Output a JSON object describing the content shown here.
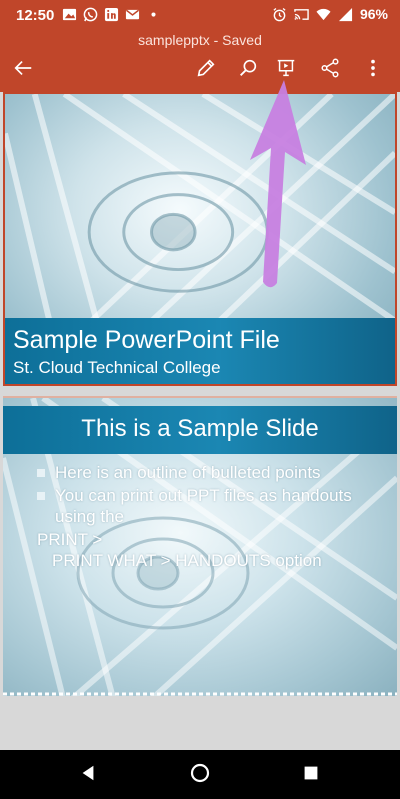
{
  "status_bar": {
    "time": "12:50",
    "battery": "96%",
    "left_icons": [
      "photo-icon",
      "whatsapp-icon",
      "linkedin-icon",
      "gmail-icon",
      "dot-icon"
    ],
    "right_icons": [
      "alarm-icon",
      "cast-icon",
      "wifi-icon",
      "signal-icon"
    ]
  },
  "app_bar": {
    "title": "samplepptx - Saved",
    "color": "#c0462a",
    "actions": [
      "back-arrow-icon",
      "edit-pencil-icon",
      "search-icon",
      "present-icon",
      "share-icon",
      "more-vertical-icon"
    ]
  },
  "slides": [
    {
      "title": "Sample PowerPoint File",
      "subtitle": "St. Cloud Technical College"
    },
    {
      "title": "This is a Sample Slide",
      "bullets": [
        "Here is an outline of bulleted points",
        "You can print out PPT files as handouts using the"
      ],
      "continuation": [
        "PRINT >",
        "PRINT WHAT > HANDOUTS option"
      ]
    }
  ],
  "annotation": {
    "color": "#c77fe0",
    "target": "present-icon"
  },
  "nav_bar": [
    "back-triangle-icon",
    "home-circle-icon",
    "recents-square-icon"
  ]
}
